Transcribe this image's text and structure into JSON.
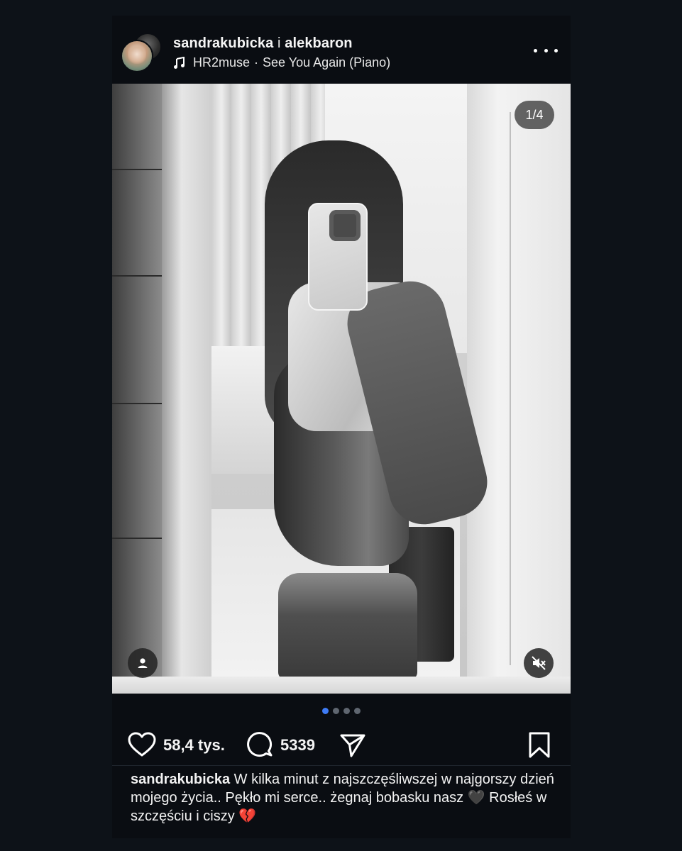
{
  "header": {
    "author_primary": "sandrakubicka",
    "separator": " i ",
    "author_secondary": "alekbaron",
    "music_artist": "HR2muse",
    "music_dot": "·",
    "music_title": "See You Again (Piano)"
  },
  "photo": {
    "page_counter": "1/4"
  },
  "carousel": {
    "total": 4,
    "active_index": 0,
    "active_color": "#3e7bf5"
  },
  "actions": {
    "likes": "58,4 tys.",
    "comments": "5339"
  },
  "caption": {
    "author": "sandrakubicka",
    "text": "W kilka minut z najszczęśliwszej w najgorszy dzień mojego życia.. Pękło mi serce.. żegnaj bobasku nasz 🖤 Rosłeś w szczęściu i ciszy 💔"
  },
  "colors": {
    "background": "#0d1218",
    "text": "#f5f5f5"
  }
}
